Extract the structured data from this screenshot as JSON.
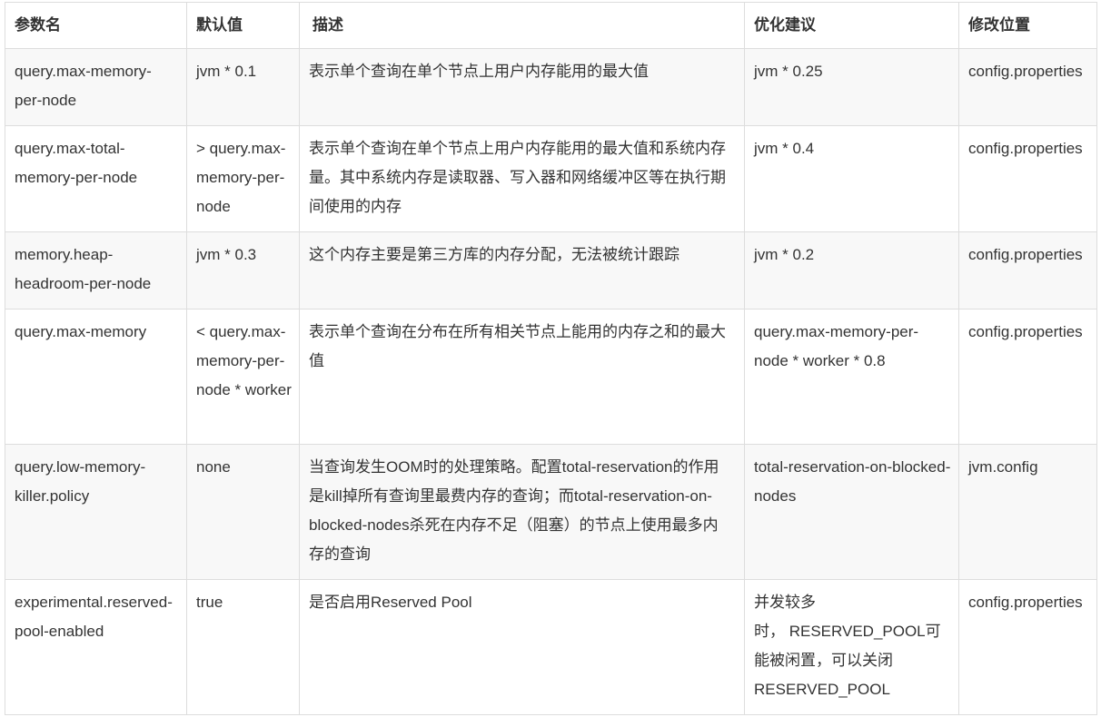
{
  "headers": [
    "参数名",
    "默认值",
    "描述",
    "优化建议",
    "修改位置"
  ],
  "rows": [
    {
      "name": "query.max-memory-per-node",
      "default": "jvm * 0.1",
      "description": "表示单个查询在单个节点上用户内存能用的最大值",
      "suggestion": "jvm * 0.25",
      "location": "config.properties"
    },
    {
      "name": "query.max-total-memory-per-node",
      "default": "> query.max-memory-per-node",
      "description": "表示单个查询在单个节点上用户内存能用的最大值和系统内存量。其中系统内存是读取器、写入器和网络缓冲区等在执行期间使用的内存",
      "suggestion": "jvm * 0.4",
      "location": "config.properties"
    },
    {
      "name": "memory.heap-headroom-per-node",
      "default": "jvm * 0.3",
      "description": "这个内存主要是第三方库的内存分配，无法被统计跟踪",
      "suggestion": "jvm * 0.2",
      "location": "config.properties"
    },
    {
      "name": "query.max-memory",
      "default": "< query.max-memory-per-node * worker",
      "description": "表示单个查询在分布在所有相关节点上能用的内存之和的最大值",
      "suggestion": "query.max-memory-per-node * worker * 0.8",
      "location": "config.properties"
    },
    {
      "name": "query.low-memory-killer.policy",
      "default": "none",
      "description": "当查询发生OOM时的处理策略。配置total-reservation的作用是kill掉所有查询里最费内存的查询；而total-reservation-on-blocked-nodes杀死在内存不足（阻塞）的节点上使用最多内存的查询",
      "suggestion": "total-reservation-on-blocked-nodes",
      "location": "jvm.config"
    },
    {
      "name": "experimental.reserved-pool-enabled",
      "default": "true",
      "description": "是否启用Reserved Pool",
      "suggestion": "并发较多\n时， RESERVED_POOL可能被闲置，可以关闭RESERVED_POOL",
      "location": "config.properties"
    }
  ]
}
